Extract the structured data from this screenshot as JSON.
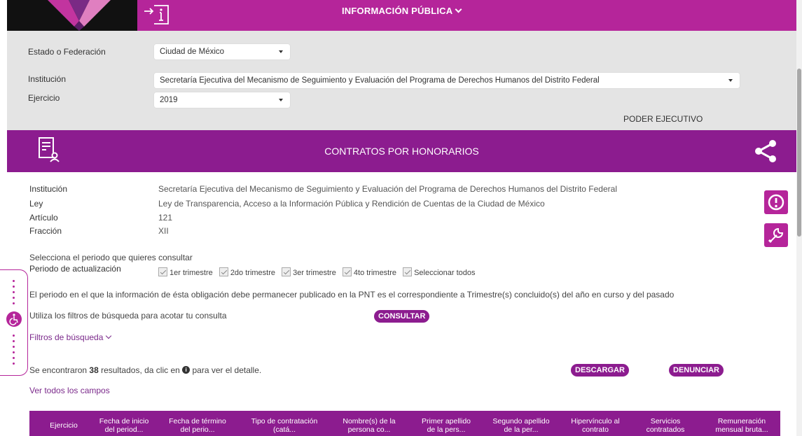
{
  "topbar": {
    "title": "INFORMACIÓN PÚBLICA"
  },
  "filters": {
    "estado_label": "Estado o Federación",
    "estado_value": "Ciudad de México",
    "institucion_label": "Institución",
    "institucion_value": "Secretaría Ejecutiva del Mecanismo de Seguimiento y Evaluación del Programa de Derechos Humanos del Distrito Federal",
    "ejercicio_label": "Ejercicio",
    "ejercicio_value": "2019",
    "poder": "PODER EJECUTIVO"
  },
  "section": {
    "title": "CONTRATOS POR HONORARIOS"
  },
  "info": [
    {
      "label": "Institución",
      "value": "Secretaría Ejecutiva del Mecanismo de Seguimiento y Evaluación del Programa de Derechos Humanos del Distrito Federal"
    },
    {
      "label": "Ley",
      "value": "Ley de Transparencia, Acceso a la Información Pública y Rendición de Cuentas de la Ciudad de México"
    },
    {
      "label": "Artículo",
      "value": "121"
    },
    {
      "label": "Fracción",
      "value": "XII"
    }
  ],
  "periodo": {
    "prompt": "Selecciona el periodo que quieres consultar",
    "label": "Periodo de actualización",
    "options": [
      "1er trimestre",
      "2do trimestre",
      "3er trimestre",
      "4to trimestre",
      "Seleccionar todos"
    ]
  },
  "notice": "El periodo en el que la información de ésta obligación debe permanecer publicado en la PNT es el correspondiente a Trimestre(s) concluido(s) del año en curso y del pasado",
  "consulta": {
    "text": "Utiliza los filtros de búsqueda para acotar tu consulta",
    "button": "CONSULTAR"
  },
  "filtros_link": "Filtros de búsqueda",
  "results": {
    "prefix": "Se encontraron ",
    "count": "38",
    "middle": " resultados, da clic en ",
    "suffix": " para ver el detalle.",
    "descargar": "DESCARGAR",
    "denunciar": "DENUNCIAR"
  },
  "ver_todos": "Ver todos los campos",
  "table": {
    "headers": [
      [
        "Ejercicio",
        ""
      ],
      [
        "Fecha de inicio",
        "del period..."
      ],
      [
        "Fecha de término",
        "del perio..."
      ],
      [
        "Tipo de contratación",
        "(catá..."
      ],
      [
        "Nombre(s) de la",
        "persona co..."
      ],
      [
        "Primer apellido",
        "de la pers..."
      ],
      [
        "Segundo apellido",
        "de la per..."
      ],
      [
        "Hipervínculo al",
        "contrato"
      ],
      [
        "Servicios",
        "contratados"
      ],
      [
        "Remuneración",
        "mensual bruta..."
      ]
    ]
  },
  "colors": {
    "magenta": "#b5259a",
    "purple": "#8c1c8f",
    "panel": "#e4e4e4"
  }
}
